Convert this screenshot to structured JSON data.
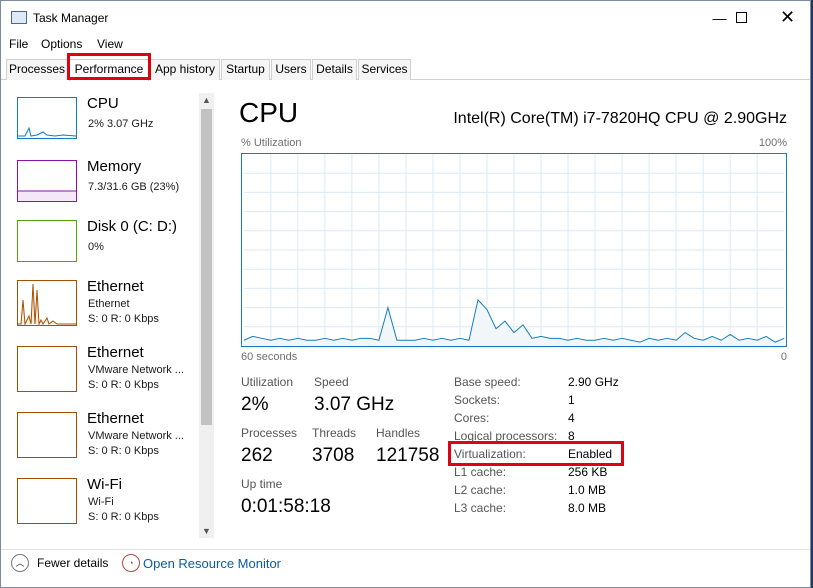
{
  "window": {
    "title": "Task Manager"
  },
  "menu": [
    "File",
    "Options",
    "View"
  ],
  "tabs": [
    "Processes",
    "Performance",
    "App history",
    "Startup",
    "Users",
    "Details",
    "Services"
  ],
  "sidebar": [
    {
      "title": "CPU",
      "sub1": "2%  3.07 GHz",
      "sub2": "",
      "color": "#117dbb"
    },
    {
      "title": "Memory",
      "sub1": "7.3/31.6 GB (23%)",
      "sub2": "",
      "color": "#8b12ae"
    },
    {
      "title": "Disk 0 (C: D:)",
      "sub1": "0%",
      "sub2": "",
      "color": "#4da60c"
    },
    {
      "title": "Ethernet",
      "sub1": "Ethernet",
      "sub2": "S: 0  R: 0 Kbps",
      "color": "#a74f01"
    },
    {
      "title": "Ethernet",
      "sub1": "VMware Network ...",
      "sub2": "S: 0  R: 0 Kbps",
      "color": "#a74f01"
    },
    {
      "title": "Ethernet",
      "sub1": "VMware Network ...",
      "sub2": "S: 0  R: 0 Kbps",
      "color": "#a74f01"
    },
    {
      "title": "Wi-Fi",
      "sub1": "Wi-Fi",
      "sub2": "S: 0  R: 0 Kbps",
      "color": "#a74f01"
    }
  ],
  "main": {
    "title": "CPU",
    "cpu_name": "Intel(R) Core(TM) i7-7820HQ CPU @ 2.90GHz",
    "graph_label": "% Utilization",
    "graph_max": "100%",
    "graph_time": "60 seconds",
    "graph_min": "0"
  },
  "stats": {
    "utilization_label": "Utilization",
    "utilization": "2%",
    "speed_label": "Speed",
    "speed": "3.07 GHz",
    "processes_label": "Processes",
    "processes": "262",
    "threads_label": "Threads",
    "threads": "3708",
    "handles_label": "Handles",
    "handles": "121758",
    "uptime_label": "Up time",
    "uptime": "0:01:58:18"
  },
  "specs": [
    {
      "label": "Base speed:",
      "value": "2.90 GHz"
    },
    {
      "label": "Sockets:",
      "value": "1"
    },
    {
      "label": "Cores:",
      "value": "4"
    },
    {
      "label": "Logical processors:",
      "value": "8"
    },
    {
      "label": "Virtualization:",
      "value": "Enabled"
    },
    {
      "label": "L1 cache:",
      "value": "256 KB"
    },
    {
      "label": "L2 cache:",
      "value": "1.0 MB"
    },
    {
      "label": "L3 cache:",
      "value": "8.0 MB"
    }
  ],
  "footer": {
    "fewer_details": "Fewer details",
    "open_monitor": "Open Resource Monitor"
  },
  "chart_data": {
    "type": "area",
    "ylim": [
      0,
      100
    ],
    "x": [
      0,
      1,
      2,
      3,
      4,
      5,
      6,
      7,
      8,
      9,
      10,
      11,
      12,
      13,
      14,
      15,
      16,
      17,
      18,
      19,
      20,
      21,
      22,
      23,
      24,
      25,
      26,
      27,
      28,
      29,
      30,
      31,
      32,
      33,
      34,
      35,
      36,
      37,
      38,
      39,
      40,
      41,
      42,
      43,
      44,
      45,
      46,
      47,
      48,
      49,
      50,
      51,
      52,
      53,
      54,
      55,
      56,
      57,
      58,
      59,
      60
    ],
    "values": [
      3,
      5,
      4,
      3,
      4,
      3,
      4,
      3,
      3,
      4,
      3,
      4,
      3,
      4,
      4,
      3,
      20,
      3,
      3,
      3,
      4,
      3,
      4,
      3,
      4,
      3,
      24,
      19,
      9,
      13,
      7,
      11,
      4,
      5,
      4,
      4,
      3,
      4,
      3,
      3,
      4,
      3,
      4,
      3,
      2,
      4,
      3,
      4,
      3,
      7,
      4,
      3,
      5,
      3,
      6,
      3,
      4,
      3,
      5,
      2,
      4
    ]
  },
  "colors": {
    "highlight": "#e0000f",
    "cpu": "#117dbb",
    "grid": "#d9eaf5",
    "fill": "#f1f6fa"
  }
}
